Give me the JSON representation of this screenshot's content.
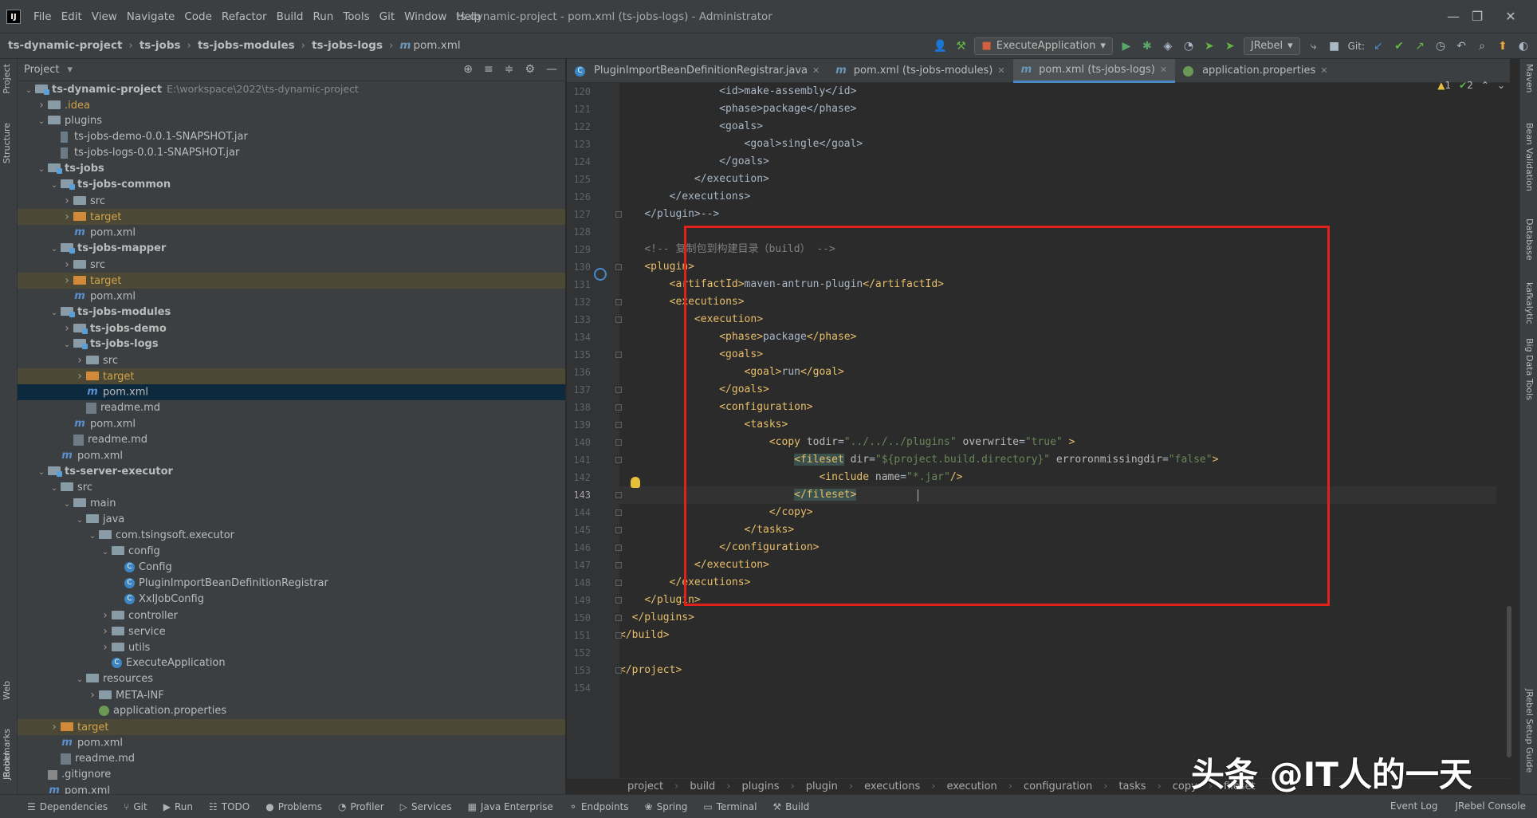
{
  "menu": [
    "File",
    "Edit",
    "View",
    "Navigate",
    "Code",
    "Refactor",
    "Build",
    "Run",
    "Tools",
    "Git",
    "Window",
    "Help"
  ],
  "window_title": "ts-dynamic-project - pom.xml (ts-jobs-logs) - Administrator",
  "breadcrumb": [
    "ts-dynamic-project",
    "ts-jobs",
    "ts-jobs-modules",
    "ts-jobs-logs",
    "pom.xml"
  ],
  "toolbar": {
    "run_config": "ExecuteApplication",
    "jrebel": "JRebel",
    "git_label": "Git:"
  },
  "project_panel": {
    "title": "Project",
    "root_path": "E:\\workspace\\2022\\ts-dynamic-project"
  },
  "tree": [
    {
      "label": "ts-dynamic-project",
      "depth": 0,
      "arrow": "v",
      "icon": "folder-module",
      "bold": true,
      "path": true
    },
    {
      "label": ".idea",
      "depth": 1,
      "arrow": ">",
      "icon": "folder-orange-text"
    },
    {
      "label": "plugins",
      "depth": 1,
      "arrow": "v",
      "icon": "folder"
    },
    {
      "label": "ts-jobs-demo-0.0.1-SNAPSHOT.jar",
      "depth": 2,
      "arrow": "",
      "icon": "jar"
    },
    {
      "label": "ts-jobs-logs-0.0.1-SNAPSHOT.jar",
      "depth": 2,
      "arrow": "",
      "icon": "jar"
    },
    {
      "label": "ts-jobs",
      "depth": 1,
      "arrow": "v",
      "icon": "folder-module",
      "bold": true
    },
    {
      "label": "ts-jobs-common",
      "depth": 2,
      "arrow": "v",
      "icon": "folder-module",
      "bold": true
    },
    {
      "label": "src",
      "depth": 3,
      "arrow": ">",
      "icon": "folder"
    },
    {
      "label": "target",
      "depth": 3,
      "arrow": ">",
      "icon": "folder-orange",
      "excluded": true
    },
    {
      "label": "pom.xml",
      "depth": 3,
      "arrow": "",
      "icon": "m"
    },
    {
      "label": "ts-jobs-mapper",
      "depth": 2,
      "arrow": "v",
      "icon": "folder-module",
      "bold": true
    },
    {
      "label": "src",
      "depth": 3,
      "arrow": ">",
      "icon": "folder"
    },
    {
      "label": "target",
      "depth": 3,
      "arrow": ">",
      "icon": "folder-orange",
      "excluded": true
    },
    {
      "label": "pom.xml",
      "depth": 3,
      "arrow": "",
      "icon": "m"
    },
    {
      "label": "ts-jobs-modules",
      "depth": 2,
      "arrow": "v",
      "icon": "folder-module",
      "bold": true
    },
    {
      "label": "ts-jobs-demo",
      "depth": 3,
      "arrow": ">",
      "icon": "folder-module",
      "bold": true
    },
    {
      "label": "ts-jobs-logs",
      "depth": 3,
      "arrow": "v",
      "icon": "folder-module",
      "bold": true
    },
    {
      "label": "src",
      "depth": 4,
      "arrow": ">",
      "icon": "folder"
    },
    {
      "label": "target",
      "depth": 4,
      "arrow": ">",
      "icon": "folder-orange",
      "excluded": true
    },
    {
      "label": "pom.xml",
      "depth": 4,
      "arrow": "",
      "icon": "m",
      "selected": true
    },
    {
      "label": "readme.md",
      "depth": 4,
      "arrow": "",
      "icon": "md"
    },
    {
      "label": "pom.xml",
      "depth": 3,
      "arrow": "",
      "icon": "m"
    },
    {
      "label": "readme.md",
      "depth": 3,
      "arrow": "",
      "icon": "md"
    },
    {
      "label": "pom.xml",
      "depth": 2,
      "arrow": "",
      "icon": "m"
    },
    {
      "label": "ts-server-executor",
      "depth": 1,
      "arrow": "v",
      "icon": "folder-module",
      "bold": true
    },
    {
      "label": "src",
      "depth": 2,
      "arrow": "v",
      "icon": "folder"
    },
    {
      "label": "main",
      "depth": 3,
      "arrow": "v",
      "icon": "folder"
    },
    {
      "label": "java",
      "depth": 4,
      "arrow": "v",
      "icon": "folder"
    },
    {
      "label": "com.tsingsoft.executor",
      "depth": 5,
      "arrow": "v",
      "icon": "folder"
    },
    {
      "label": "config",
      "depth": 6,
      "arrow": "v",
      "icon": "folder"
    },
    {
      "label": "Config",
      "depth": 7,
      "arrow": "",
      "icon": "class"
    },
    {
      "label": "PluginImportBeanDefinitionRegistrar",
      "depth": 7,
      "arrow": "",
      "icon": "class"
    },
    {
      "label": "XxlJobConfig",
      "depth": 7,
      "arrow": "",
      "icon": "class"
    },
    {
      "label": "controller",
      "depth": 6,
      "arrow": ">",
      "icon": "folder"
    },
    {
      "label": "service",
      "depth": 6,
      "arrow": ">",
      "icon": "folder"
    },
    {
      "label": "utils",
      "depth": 6,
      "arrow": ">",
      "icon": "folder"
    },
    {
      "label": "ExecuteApplication",
      "depth": 6,
      "arrow": "",
      "icon": "class"
    },
    {
      "label": "resources",
      "depth": 4,
      "arrow": "v",
      "icon": "folder"
    },
    {
      "label": "META-INF",
      "depth": 5,
      "arrow": ">",
      "icon": "folder"
    },
    {
      "label": "application.properties",
      "depth": 5,
      "arrow": "",
      "icon": "prop"
    },
    {
      "label": "target",
      "depth": 2,
      "arrow": ">",
      "icon": "folder-orange",
      "excluded": true
    },
    {
      "label": "pom.xml",
      "depth": 2,
      "arrow": "",
      "icon": "m"
    },
    {
      "label": "readme.md",
      "depth": 2,
      "arrow": "",
      "icon": "md"
    },
    {
      "label": ".gitignore",
      "depth": 1,
      "arrow": "",
      "icon": "git"
    },
    {
      "label": "pom.xml",
      "depth": 1,
      "arrow": "",
      "icon": "m"
    }
  ],
  "tabs": [
    {
      "label": "PluginImportBeanDefinitionRegistrar.java",
      "icon": "class"
    },
    {
      "label": "pom.xml (ts-jobs-modules)",
      "icon": "m"
    },
    {
      "label": "pom.xml (ts-jobs-logs)",
      "icon": "m",
      "active": true
    },
    {
      "label": "application.properties",
      "icon": "prop"
    }
  ],
  "inspections": {
    "warnings": "1",
    "weak": "2"
  },
  "code_lines": [
    {
      "n": "120",
      "html": "                <span class='txt'>&lt;id&gt;make-assembly&lt;/id&gt;</span>"
    },
    {
      "n": "121",
      "html": "                <span class='txt'>&lt;phase&gt;package&lt;/phase&gt;</span>"
    },
    {
      "n": "122",
      "html": "                <span class='txt'>&lt;goals&gt;</span>"
    },
    {
      "n": "123",
      "html": "                    <span class='txt'>&lt;goal&gt;single&lt;/goal&gt;</span>"
    },
    {
      "n": "124",
      "html": "                <span class='txt'>&lt;/goals&gt;</span>"
    },
    {
      "n": "125",
      "html": "            <span class='txt'>&lt;/execution&gt;</span>"
    },
    {
      "n": "126",
      "html": "        <span class='txt'>&lt;/executions&gt;</span>"
    },
    {
      "n": "127",
      "html": "    <span class='txt'>&lt;/plugin&gt;--&gt;</span>"
    },
    {
      "n": "128",
      "html": ""
    },
    {
      "n": "129",
      "html": "    <span class='cmt'>&lt;!-- 复制包到构建目录（build） --&gt;</span>"
    },
    {
      "n": "130",
      "html": "    <span class='tag'>&lt;plugin&gt;</span>"
    },
    {
      "n": "131",
      "html": "        <span class='tag'>&lt;artifactId&gt;</span>maven-antrun-plugin<span class='tag'>&lt;/artifactId&gt;</span>"
    },
    {
      "n": "132",
      "html": "        <span class='tag'>&lt;executions&gt;</span>"
    },
    {
      "n": "133",
      "html": "            <span class='tag'>&lt;execution&gt;</span>"
    },
    {
      "n": "134",
      "html": "                <span class='tag'>&lt;phase&gt;</span>package<span class='tag'>&lt;/phase&gt;</span>"
    },
    {
      "n": "135",
      "html": "                <span class='tag'>&lt;goals&gt;</span>"
    },
    {
      "n": "136",
      "html": "                    <span class='tag'>&lt;goal&gt;</span>run<span class='tag'>&lt;/goal&gt;</span>"
    },
    {
      "n": "137",
      "html": "                <span class='tag'>&lt;/goals&gt;</span>"
    },
    {
      "n": "138",
      "html": "                <span class='tag'>&lt;configuration&gt;</span>"
    },
    {
      "n": "139",
      "html": "                    <span class='tag'>&lt;tasks&gt;</span>"
    },
    {
      "n": "140",
      "html": "                        <span class='tag'>&lt;copy </span><span class='attr'>todir</span>=<span class='val'>\"../../../plugins\"</span> <span class='attr'>overwrite</span>=<span class='val'>\"true\"</span> <span class='tag'>&gt;</span>"
    },
    {
      "n": "141",
      "html": "                            <span class='tag hl'>&lt;fileset</span><span class='tag'> </span><span class='attr'>dir</span>=<span class='val'>\"${project.build.directory}\"</span> <span class='attr'>erroronmissingdir</span>=<span class='val'>\"false\"</span><span class='tag'>&gt;</span>"
    },
    {
      "n": "142",
      "html": "                                <span class='tag'>&lt;include </span><span class='attr'>name</span>=<span class='val'>\"*.jar\"</span><span class='tag'>/&gt;</span>"
    },
    {
      "n": "143",
      "html": "                            <span class='tag hl'>&lt;/fileset&gt;</span>",
      "current": true
    },
    {
      "n": "144",
      "html": "                        <span class='tag'>&lt;/copy&gt;</span>"
    },
    {
      "n": "145",
      "html": "                    <span class='tag'>&lt;/tasks&gt;</span>"
    },
    {
      "n": "146",
      "html": "                <span class='tag'>&lt;/configuration&gt;</span>"
    },
    {
      "n": "147",
      "html": "            <span class='tag'>&lt;/execution&gt;</span>"
    },
    {
      "n": "148",
      "html": "        <span class='tag'>&lt;/executions&gt;</span>"
    },
    {
      "n": "149",
      "html": "    <span class='tag'>&lt;/plugin&gt;</span>"
    },
    {
      "n": "150",
      "html": "  <span class='tag'>&lt;/plugins&gt;</span>"
    },
    {
      "n": "151",
      "html": "<span class='tag'>&lt;/build&gt;</span>"
    },
    {
      "n": "152",
      "html": ""
    },
    {
      "n": "153",
      "html": "<span class='tag'>&lt;/project&gt;</span>"
    },
    {
      "n": "154",
      "html": ""
    }
  ],
  "editor_breadcrumb": [
    "project",
    "build",
    "plugins",
    "plugin",
    "executions",
    "execution",
    "configuration",
    "tasks",
    "copy",
    "fileset"
  ],
  "bottom_tools": [
    "Dependencies",
    "Git",
    "Run",
    "TODO",
    "Problems",
    "Profiler",
    "Services",
    "Java Enterprise",
    "Endpoints",
    "Spring",
    "Terminal",
    "Build"
  ],
  "bottom_right": [
    "Event Log",
    "JRebel Console"
  ],
  "left_tabs": [
    "Project",
    "Structure",
    "Web",
    "Bookmarks",
    "JRebel"
  ],
  "right_tabs": [
    "Maven",
    "Bean Validation",
    "Database",
    "kafkalytic",
    "Big Data Tools",
    "JRebel Setup Guide"
  ],
  "watermark": "头条 @IT人的一天",
  "accent": "#4a88c7",
  "highlight_box_color": "#e0221c"
}
